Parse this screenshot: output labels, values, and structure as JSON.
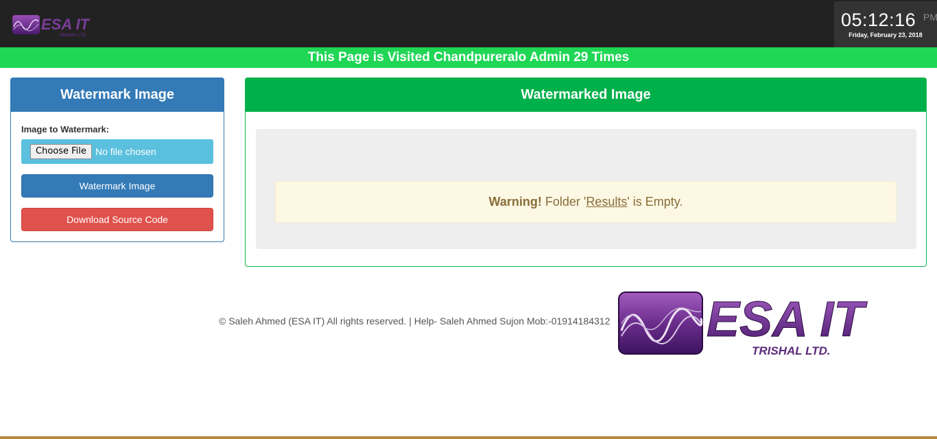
{
  "header": {
    "logo_text": "ESA IT",
    "logo_subtext": "TRISHAL LTD.",
    "clock": {
      "time": "05:12:16",
      "ampm": "PM",
      "date": "Friday, February 23, 2018"
    }
  },
  "banner": {
    "text": "This Page is Visited Chandpureralo Admin 29 Times"
  },
  "left_panel": {
    "title": "Watermark Image",
    "field_label": "Image to Watermark:",
    "choose_file_label": "Choose File",
    "file_status": "No file chosen",
    "watermark_button": "Watermark Image",
    "download_button": "Download Source Code"
  },
  "right_panel": {
    "title": "Watermarked Image",
    "warning": {
      "strong": "Warning!",
      "prefix": " Folder '",
      "link": "Results",
      "suffix": "' is Empty."
    }
  },
  "footer": {
    "text": "© Saleh Ahmed (ESA IT) All rights reserved. | Help- Saleh Ahmed Sujon Mob:-01914184312"
  },
  "colors": {
    "primary": "#337ab7",
    "success": "#00b04a",
    "banner": "#1fd655",
    "danger": "#e0524d",
    "info": "#5bc0de",
    "logo_purple": "#6b2d8c"
  }
}
